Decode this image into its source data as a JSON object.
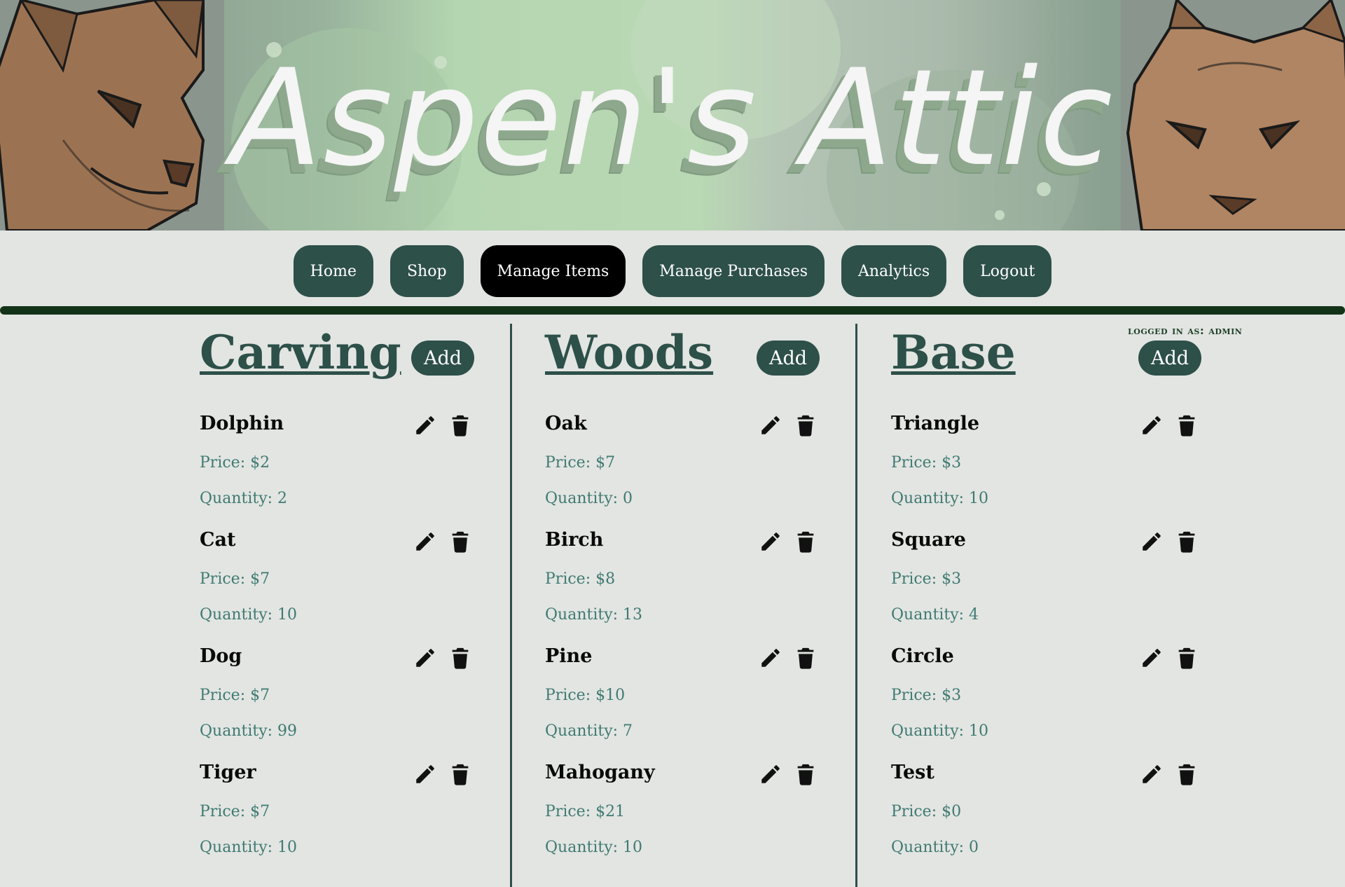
{
  "banner": {
    "title": "Aspen's Attic"
  },
  "nav": {
    "items": [
      {
        "label": "Home"
      },
      {
        "label": "Shop"
      },
      {
        "label": "Manage Items",
        "active": true
      },
      {
        "label": "Manage Purchases"
      },
      {
        "label": "Analytics"
      },
      {
        "label": "Logout"
      }
    ]
  },
  "user": {
    "logged_in_text": "logged in as: admin"
  },
  "columns": [
    {
      "title": "Carving",
      "add_label": "Add",
      "items": [
        {
          "name": "Dolphin",
          "price": "Price: $2",
          "quantity": "Quantity: 2"
        },
        {
          "name": "Cat",
          "price": "Price: $7",
          "quantity": "Quantity: 10"
        },
        {
          "name": "Dog",
          "price": "Price: $7",
          "quantity": "Quantity: 99"
        },
        {
          "name": "Tiger",
          "price": "Price: $7",
          "quantity": "Quantity: 10"
        }
      ]
    },
    {
      "title": "Woods",
      "add_label": "Add",
      "items": [
        {
          "name": "Oak",
          "price": "Price: $7",
          "quantity": "Quantity: 0"
        },
        {
          "name": "Birch",
          "price": "Price: $8",
          "quantity": "Quantity: 13"
        },
        {
          "name": "Pine",
          "price": "Price: $10",
          "quantity": "Quantity: 7"
        },
        {
          "name": "Mahogany",
          "price": "Price: $21",
          "quantity": "Quantity: 10"
        }
      ]
    },
    {
      "title": "Base",
      "add_label": "Add",
      "items": [
        {
          "name": "Triangle",
          "price": "Price: $3",
          "quantity": "Quantity: 10"
        },
        {
          "name": "Square",
          "price": "Price: $3",
          "quantity": "Quantity: 4"
        },
        {
          "name": "Circle",
          "price": "Price: $3",
          "quantity": "Quantity: 10"
        },
        {
          "name": "Test",
          "price": "Price: $0",
          "quantity": "Quantity: 0"
        }
      ]
    }
  ],
  "icons": {
    "edit": "pencil-icon",
    "delete": "trash-icon"
  },
  "colors": {
    "accent": "#2d5049",
    "active_nav": "#000000",
    "divider": "#133319",
    "muted_text": "#3f7a72",
    "background": "#e3e5e2"
  }
}
